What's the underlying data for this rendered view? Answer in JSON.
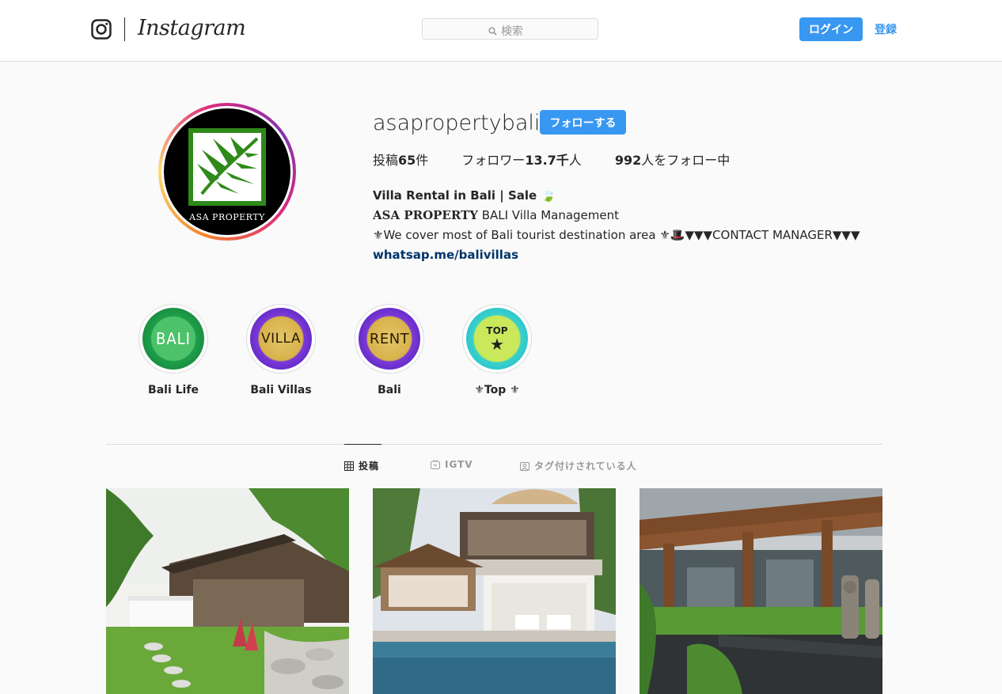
{
  "header": {
    "wordmark": "Instagram",
    "search_placeholder": "検索",
    "login_label": "ログイン",
    "signup_label": "登録"
  },
  "profile": {
    "username": "asapropertybali",
    "follow_label": "フォローする",
    "avatar_text": "ASA PROPERTY",
    "stats": {
      "posts_prefix": "投稿",
      "posts_count": "65",
      "posts_suffix": "件",
      "followers_prefix": "フォロワー",
      "followers_count": "13.7千",
      "followers_suffix": "人",
      "following_count": "992",
      "following_suffix": "人をフォロー中"
    },
    "bio": {
      "name": "Villa Rental in Bali | Sale 🍃",
      "brand": "ASA PROPERTY",
      "brand_rest": " BALI Villa Management",
      "line3": "⚜We cover most of Bali tourist destination area ⚜🎩▼▼▼CONTACT MANAGER▼▼▼",
      "link": "whatsap.me/balivillas"
    }
  },
  "highlights": [
    {
      "label": "Bali Life",
      "badge": "BALI",
      "colors": [
        "#1e9e4a",
        "#4cc26a"
      ]
    },
    {
      "label": "Bali Villas",
      "badge": "VILLA",
      "colors": [
        "#5b1fd6",
        "#d8b24a"
      ]
    },
    {
      "label": "Bali",
      "badge": "RENT",
      "colors": [
        "#5b1fd6",
        "#d8b24a"
      ]
    },
    {
      "label": "⚜Top ⚜",
      "badge": "TOP",
      "colors": [
        "#22c6d8",
        "#c9e85a"
      ]
    }
  ],
  "tabs": {
    "posts": "投稿",
    "igtv": "IGTV",
    "tagged": "タグ付けされている人"
  },
  "colors": {
    "accent": "#3897f0",
    "link": "#003569",
    "text": "#262626",
    "muted": "#999999"
  }
}
